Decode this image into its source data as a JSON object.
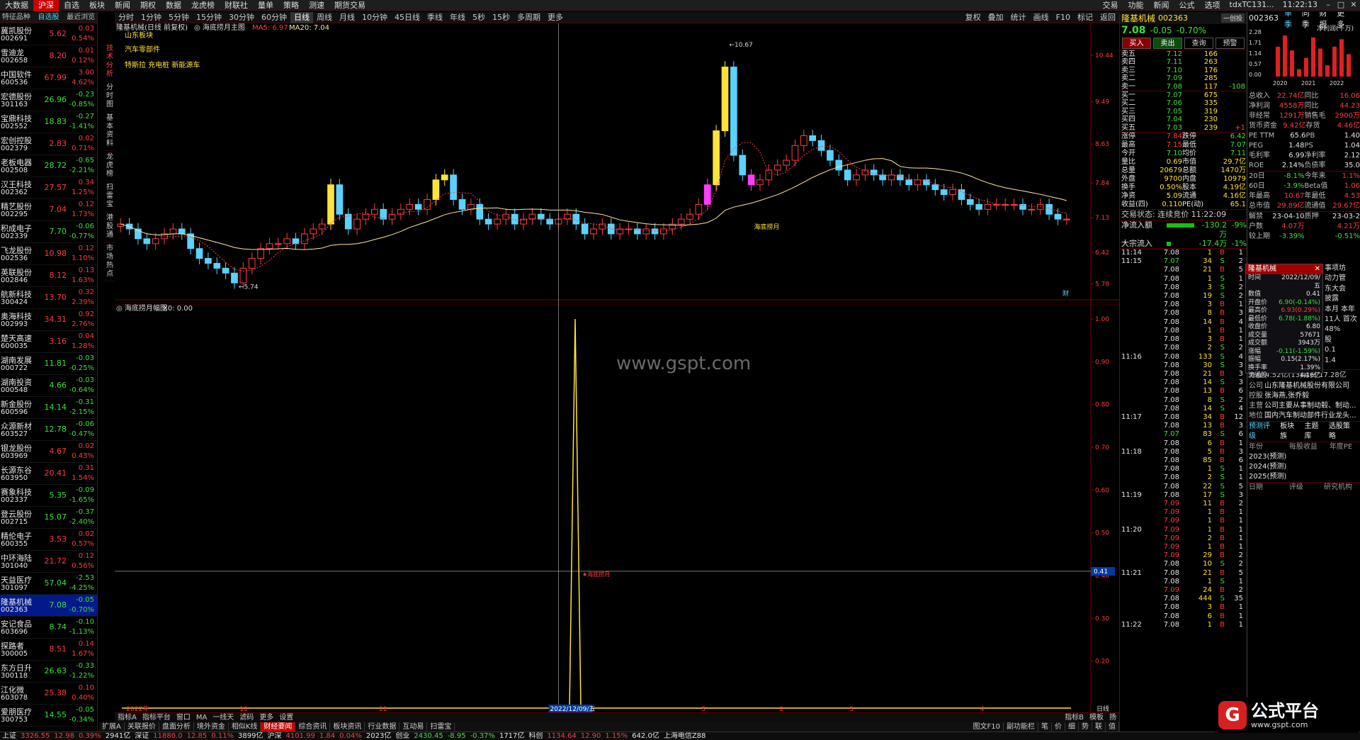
{
  "topbar": {
    "items": [
      "大数据",
      "沪深",
      "自选",
      "板块",
      "新闻",
      "期权",
      "数据",
      "龙虎榜",
      "财联社",
      "量单",
      "策略",
      "测速",
      "期货交易"
    ],
    "right": [
      "交易",
      "功能",
      "新闻",
      "公式",
      "选项"
    ],
    "account": "tdxTC131...",
    "time": "11:22:13",
    "active": "沪深"
  },
  "watchlist": {
    "tabs": [
      "特征品种",
      "自选股",
      "最近浏览"
    ],
    "rows": [
      {
        "name": "冀凯股份",
        "code": "002691",
        "price": "5.62",
        "chg": "0.03",
        "pct": "0.54%"
      },
      {
        "name": "雪迪龙",
        "code": "002658",
        "price": "8.20",
        "chg": "0.01",
        "pct": "0.12%"
      },
      {
        "name": "中国软件",
        "code": "600536",
        "price": "67.99",
        "chg": "3.00",
        "pct": "4.62%"
      },
      {
        "name": "宏德股份",
        "code": "301163",
        "price": "26.96",
        "chg": "-0.23",
        "pct": "-0.85%"
      },
      {
        "name": "宝鼎科技",
        "code": "002552",
        "price": "18.83",
        "chg": "-0.27",
        "pct": "-1.41%"
      },
      {
        "name": "宏创控股",
        "code": "002379",
        "price": "2.83",
        "chg": "0.02",
        "pct": "0.71%"
      },
      {
        "name": "老板电器",
        "code": "002508",
        "price": "28.72",
        "chg": "-0.65",
        "pct": "-2.21%"
      },
      {
        "name": "汉王科技",
        "code": "002362",
        "price": "27.57",
        "chg": "0.34",
        "pct": "1.25%"
      },
      {
        "name": "精艺股份",
        "code": "002295",
        "price": "7.04",
        "chg": "0.12",
        "pct": "1.73%"
      },
      {
        "name": "积成电子",
        "code": "002339",
        "price": "7.70",
        "chg": "-0.06",
        "pct": "-0.77%"
      },
      {
        "name": "飞龙股份",
        "code": "002536",
        "price": "10.98",
        "chg": "0.12",
        "pct": "1.10%"
      },
      {
        "name": "英联股份",
        "code": "002846",
        "price": "8.12",
        "chg": "0.13",
        "pct": "1.63%"
      },
      {
        "name": "航新科技",
        "code": "300424",
        "price": "13.70",
        "chg": "0.32",
        "pct": "2.39%"
      },
      {
        "name": "奥海科技",
        "code": "002993",
        "price": "34.31",
        "chg": "0.92",
        "pct": "2.76%"
      },
      {
        "name": "楚天高速",
        "code": "600035",
        "price": "3.16",
        "chg": "0.04",
        "pct": "1.28%"
      },
      {
        "name": "湖南发展",
        "code": "000722",
        "price": "11.81",
        "chg": "-0.03",
        "pct": "-0.25%"
      },
      {
        "name": "湖南投资",
        "code": "000548",
        "price": "4.66",
        "chg": "-0.03",
        "pct": "-0.64%"
      },
      {
        "name": "新金股份",
        "code": "600596",
        "price": "14.14",
        "chg": "-0.31",
        "pct": "-2.15%"
      },
      {
        "name": "众源新材",
        "code": "603527",
        "price": "12.78",
        "chg": "-0.06",
        "pct": "-0.47%"
      },
      {
        "name": "银龙股份",
        "code": "603969",
        "price": "4.67",
        "chg": "0.02",
        "pct": "0.43%"
      },
      {
        "name": "长源东谷",
        "code": "603950",
        "price": "20.41",
        "chg": "0.31",
        "pct": "1.54%"
      },
      {
        "name": "赛象科技",
        "code": "002337",
        "price": "5.35",
        "chg": "-0.09",
        "pct": "-1.65%"
      },
      {
        "name": "登云股份",
        "code": "002715",
        "price": "15.07",
        "chg": "-0.37",
        "pct": "-2.40%"
      },
      {
        "name": "精伦电子",
        "code": "600355",
        "price": "3.53",
        "chg": "0.02",
        "pct": "0.57%"
      },
      {
        "name": "中环海陆",
        "code": "301040",
        "price": "21.72",
        "chg": "0.12",
        "pct": "0.56%"
      },
      {
        "name": "天益医疗",
        "code": "301097",
        "price": "57.04",
        "chg": "-2.53",
        "pct": "-4.25%"
      },
      {
        "name": "隆基机械",
        "code": "002363",
        "price": "7.08",
        "chg": "-0.05",
        "pct": "-0.70%"
      },
      {
        "name": "安记食品",
        "code": "603696",
        "price": "8.74",
        "chg": "-0.10",
        "pct": "-1.13%"
      },
      {
        "name": "探路者",
        "code": "300005",
        "price": "8.51",
        "chg": "0.14",
        "pct": "1.67%"
      },
      {
        "name": "东方日升",
        "code": "300118",
        "price": "26.63",
        "chg": "-0.33",
        "pct": "-1.22%"
      },
      {
        "name": "江化微",
        "code": "603078",
        "price": "25.38",
        "chg": "0.10",
        "pct": "0.40%"
      },
      {
        "name": "爱朋医疗",
        "code": "300753",
        "price": "14.55",
        "chg": "-0.05",
        "pct": "-0.34%"
      }
    ],
    "selected_index": 26
  },
  "vtabs": [
    "技术分析",
    "分时图",
    "基本资料",
    "龙虎榜",
    "扫雷宝",
    "港股通",
    "市场热点"
  ],
  "periodbar": {
    "items": [
      "分时",
      "1分钟",
      "5分钟",
      "15分钟",
      "30分钟",
      "60分钟",
      "日线",
      "周线",
      "月线",
      "10分钟",
      "45日线",
      "季线",
      "年线",
      "5秒",
      "15秒",
      "多周期",
      "更多"
    ],
    "selected": "日线",
    "tools": [
      "复权",
      "叠加",
      "统计",
      "画线",
      "F10",
      "标记",
      "返回"
    ]
  },
  "chart": {
    "title_stock": "隆基机械(日线 前复权)",
    "title_indicator": "海底捞月主图",
    "ma5": "MA5: 6.97",
    "ma20": "MA20: 7.04",
    "concepts": [
      "山东板块",
      "汽车零部件",
      "特斯拉 充电桩 新能源车"
    ],
    "price_axis": [
      "10.44",
      "9.49",
      "8.63",
      "7.84",
      "7.13",
      "6.42",
      "5.78"
    ],
    "high_label": "10.67",
    "low_label": "5.74",
    "signal_label": "海底捞月",
    "sub_title": "海底捞月幅图",
    "sub_value": "X0: 0.00",
    "sub_axis": [
      "1.00",
      "0.90",
      "0.80",
      "0.70",
      "0.60",
      "0.50",
      "0.40",
      "0.30",
      "0.20"
    ],
    "sub_marker": "0.41",
    "sub_signal": "海底捞月",
    "time_labels": [
      "2022年",
      "10",
      "11",
      "12",
      "3",
      "2",
      "3",
      "4"
    ],
    "cursor_date": "2022/12/09/五",
    "axis_tag": "日线",
    "watermark_mid": "财",
    "watermark": "www.gspt.com"
  },
  "chart_data": {
    "type": "candlestick",
    "price_range": [
      5.6,
      10.8
    ],
    "candles_close": [
      7.0,
      6.9,
      6.7,
      6.6,
      6.7,
      6.8,
      6.9,
      6.8,
      6.5,
      6.3,
      6.2,
      6.1,
      6.0,
      5.8,
      6.1,
      6.3,
      6.5,
      6.6,
      6.6,
      6.7,
      6.6,
      6.8,
      6.9,
      7.0,
      7.8,
      7.2,
      6.9,
      7.1,
      7.2,
      7.3,
      7.1,
      7.2,
      7.3,
      7.4,
      7.3,
      7.5,
      7.9,
      8.0,
      7.5,
      7.3,
      7.4,
      7.1,
      7.0,
      7.1,
      7.2,
      7.0,
      7.1,
      7.2,
      7.1,
      7.0,
      7.1,
      7.2,
      7.0,
      6.8,
      6.9,
      7.0,
      6.8,
      6.9,
      6.9,
      6.8,
      6.9,
      6.8,
      6.9,
      7.0,
      7.1,
      7.2,
      7.4,
      7.8,
      8.9,
      10.2,
      8.4,
      8.0,
      7.8,
      7.9,
      8.1,
      8.2,
      8.3,
      8.6,
      8.8,
      8.7,
      8.5,
      8.3,
      8.1,
      7.9,
      8.0,
      8.1,
      8.0,
      7.9,
      8.0,
      7.9,
      7.8,
      7.9,
      7.8,
      7.7,
      7.6,
      7.7,
      7.5,
      7.4,
      7.3,
      7.4,
      7.4,
      7.4,
      7.4,
      7.3,
      7.3,
      7.4,
      7.2,
      7.1,
      7.1
    ],
    "subchart_signal_x": 0.48,
    "subchart_peak": 1.0
  },
  "right_panel": {
    "name": "隆基机械",
    "code": "002363",
    "btn": "一创投",
    "price": "7.08",
    "chg": "-0.05",
    "pct": "-0.70%",
    "trade_buttons": [
      "买入",
      "卖出",
      "查询",
      "预警"
    ],
    "asks": [
      {
        "l": "卖五",
        "p": "7.12",
        "v": "166",
        "x": ""
      },
      {
        "l": "卖四",
        "p": "7.11",
        "v": "263",
        "x": ""
      },
      {
        "l": "卖三",
        "p": "7.10",
        "v": "176",
        "x": ""
      },
      {
        "l": "卖二",
        "p": "7.09",
        "v": "285",
        "x": ""
      },
      {
        "l": "卖一",
        "p": "7.08",
        "v": "117",
        "x": "-108"
      }
    ],
    "bids": [
      {
        "l": "买一",
        "p": "7.07",
        "v": "675",
        "x": ""
      },
      {
        "l": "买二",
        "p": "7.06",
        "v": "335",
        "x": ""
      },
      {
        "l": "买三",
        "p": "7.05",
        "v": "319",
        "x": ""
      },
      {
        "l": "买四",
        "p": "7.04",
        "v": "230",
        "x": ""
      },
      {
        "l": "买五",
        "p": "7.03",
        "v": "239",
        "x": "+1"
      }
    ],
    "stats": [
      [
        "涨停",
        "7.84",
        "跌停",
        "6.42"
      ],
      [
        "最高",
        "7.15",
        "最低",
        "7.07"
      ],
      [
        "今开",
        "7.10",
        "均价",
        "7.11"
      ],
      [
        "量比",
        "0.69",
        "市值",
        "29.7亿"
      ],
      [
        "总量",
        "20679",
        "总额",
        "1470万"
      ],
      [
        "外盘",
        "9700",
        "内盘",
        "10979"
      ],
      [
        "换手",
        "0.50%",
        "股本",
        "4.19亿"
      ],
      [
        "净资",
        "5.09",
        "流通",
        "4.16亿"
      ],
      [
        "收益(四)",
        "0.110",
        "PE(动)",
        "65.1"
      ]
    ],
    "trade_status": "交易状态: 连续竞价 11:22:09",
    "flow1_label": "净流入额",
    "flow1_val": "-130.2万",
    "flow1_pct": "-9%",
    "flow2_label": "大宗流入",
    "flow2_val": "-17.4万",
    "flow2_pct": "-1%",
    "ticks": [
      [
        "11:14",
        "7.08",
        "1",
        "B",
        "1"
      ],
      [
        "11:15",
        "7.07",
        "34",
        "S",
        "2"
      ],
      [
        "",
        "7.08",
        "21",
        "B",
        "5"
      ],
      [
        "",
        "7.08",
        "1",
        "S",
        "1"
      ],
      [
        "",
        "7.08",
        "3",
        "S",
        "2"
      ],
      [
        "",
        "7.08",
        "19",
        "S",
        "2"
      ],
      [
        "",
        "7.08",
        "3",
        "B",
        "1"
      ],
      [
        "",
        "7.08",
        "8",
        "B",
        "3"
      ],
      [
        "",
        "7.08",
        "14",
        "B",
        "4"
      ],
      [
        "",
        "7.08",
        "1",
        "B",
        "1"
      ],
      [
        "",
        "7.08",
        "3",
        "B",
        "1"
      ],
      [
        "",
        "7.08",
        "2",
        "S",
        "2"
      ],
      [
        "11:16",
        "7.08",
        "133",
        "S",
        "4"
      ],
      [
        "",
        "7.08",
        "30",
        "S",
        "3"
      ],
      [
        "",
        "7.08",
        "21",
        "B",
        "3"
      ],
      [
        "",
        "7.08",
        "14",
        "S",
        "3"
      ],
      [
        "",
        "7.08",
        "13",
        "B",
        "6"
      ],
      [
        "",
        "7.08",
        "8",
        "S",
        "2"
      ],
      [
        "",
        "7.08",
        "14",
        "S",
        "4"
      ],
      [
        "11:17",
        "7.08",
        "34",
        "B",
        "12"
      ],
      [
        "",
        "7.08",
        "13",
        "B",
        "3"
      ],
      [
        "",
        "7.07",
        "83",
        "S",
        "6"
      ],
      [
        "",
        "7.08",
        "6",
        "B",
        "1"
      ],
      [
        "11:18",
        "7.08",
        "5",
        "B",
        "3"
      ],
      [
        "",
        "7.08",
        "85",
        "B",
        "6"
      ],
      [
        "",
        "7.08",
        "1",
        "S",
        "1"
      ],
      [
        "",
        "7.08",
        "2",
        "S",
        "1"
      ],
      [
        "",
        "7.08",
        "22",
        "S",
        "5"
      ],
      [
        "11:19",
        "7.08",
        "17",
        "S",
        "3"
      ],
      [
        "",
        "7.09",
        "11",
        "B",
        "2"
      ],
      [
        "",
        "7.09",
        "1",
        "B",
        "1"
      ],
      [
        "",
        "7.09",
        "1",
        "B",
        "1"
      ],
      [
        "11:20",
        "7.09",
        "1",
        "B",
        "1"
      ],
      [
        "",
        "7.09",
        "2",
        "B",
        "1"
      ],
      [
        "",
        "7.09",
        "1",
        "B",
        "1"
      ],
      [
        "",
        "7.09",
        "29",
        "B",
        "2"
      ],
      [
        "",
        "7.08",
        "10",
        "S",
        "2"
      ],
      [
        "11:21",
        "7.08",
        "21",
        "B",
        "5"
      ],
      [
        "",
        "7.08",
        "1",
        "S",
        "1"
      ],
      [
        "",
        "7.09",
        "24",
        "B",
        "2"
      ],
      [
        "",
        "7.08",
        "444",
        "S",
        "35"
      ],
      [
        "",
        "7.08",
        "3",
        "B",
        "1"
      ],
      [
        "",
        "7.08",
        "6",
        "B",
        "1"
      ],
      [
        "11:22",
        "7.08",
        "1",
        "B",
        "1"
      ]
    ]
  },
  "far_panel": {
    "code": "002363",
    "tabs": [
      "单季",
      "同季",
      "财报",
      "更多"
    ],
    "chart_label": "净利润(千万)",
    "chart_axis": [
      "2.28",
      "1.71",
      "1.14",
      "0.57",
      "0.00"
    ],
    "bar_years": [
      "2020",
      "2021",
      "2022"
    ],
    "bar_values": [
      1.6,
      2.2,
      1.4,
      0.4,
      1.0,
      2.1,
      1.5,
      0.6,
      1.6,
      2.0,
      1.2
    ],
    "rows": [
      [
        "总收入",
        "22.74亿",
        "同比",
        "16.06"
      ],
      [
        "净利润",
        "4558万",
        "同比",
        "44.23"
      ],
      [
        "非经常",
        "1291万",
        "销售毛",
        "2900万"
      ],
      [
        "货币资金",
        "9.42亿",
        "存货",
        "4.46亿"
      ],
      [
        "PE TTM",
        "65.6",
        "PB",
        "1.40"
      ],
      [
        "PEG",
        "1.48",
        "PS",
        "1.04"
      ],
      [
        "毛利率",
        "6.99",
        "净利率",
        "2.12"
      ],
      [
        "ROE",
        "2.14%",
        "负债率",
        "35.0"
      ]
    ],
    "rows2": [
      [
        "20日",
        "-8.1%",
        "今年来",
        "1.1%"
      ],
      [
        "60日",
        "-3.9%",
        "Beta值",
        "1.06"
      ],
      [
        "年最高",
        "10.67",
        "年最低",
        "4.53"
      ],
      [
        "总市值",
        "29.89亿",
        "流通值",
        "29.67亿"
      ]
    ],
    "rows3": [
      [
        "解禁",
        "23-04-10",
        "质押",
        "23-03-2"
      ],
      [
        "户数",
        "4.07万",
        "",
        "4.21万"
      ],
      [
        "较上期",
        "-3.39%",
        "",
        "-0.51%"
      ]
    ],
    "popup": {
      "title": "隆基机械",
      "rows": [
        [
          "时间",
          "2022/12/09/五"
        ],
        [
          "数值",
          "0.41"
        ],
        [
          "开盘价",
          "6.90(-0.14%)"
        ],
        [
          "最高价",
          "6.93(0.29%)"
        ],
        [
          "最低价",
          "6.78(-1.88%)"
        ],
        [
          "收盘价",
          "6.80"
        ],
        [
          "成交量",
          "57671"
        ],
        [
          "成交额",
          "3943万"
        ],
        [
          "涨幅",
          "-0.11(-1.59%)"
        ],
        [
          "振幅",
          "0.15(2.17%)"
        ],
        [
          "换手率",
          "1.39%"
        ],
        [
          "流通股",
          "4.16亿"
        ]
      ]
    },
    "side_text": [
      "事项坊",
      "动力管",
      "东大会",
      "披露",
      "本月 本年",
      "11人 首次",
      "48%",
      "股",
      "0.1",
      "1.4"
    ],
    "fenhong": "分红  4.52亿(13)募资  17.28亿",
    "company_rows": [
      [
        "公司",
        "山东隆基机械股份有限公司"
      ],
      [
        "控股",
        "张海燕,张乔毅"
      ],
      [
        "主营",
        "公司主要从事制动毂、制动..."
      ],
      [
        "地位",
        "国内汽车制动部件行业龙头..."
      ]
    ],
    "pred_tabs": [
      "预测评级",
      "板块族",
      "主题库",
      "选股策略"
    ],
    "pred_header": [
      "年份",
      "每股收益",
      "年度PE"
    ],
    "pred_years": [
      "2023(预测)",
      "2024(预测)",
      "2025(预测)"
    ],
    "rating_header": [
      "日期",
      "评级",
      "研究机构"
    ]
  },
  "bottom_tabs": [
    "指标A",
    "指标平台",
    "窗口",
    "MA",
    "一线天",
    "滤码",
    "更多",
    "设置"
  ],
  "bottom_tabs_right": [
    "指标B",
    "模板",
    "扬"
  ],
  "bottom_tabs2": [
    "扩展A",
    "关联报价",
    "盘面分析",
    "境外资金",
    "相似K线",
    "财经要闻",
    "综合资讯",
    "板块资讯",
    "行业数据",
    "互动易",
    "扫雷宝"
  ],
  "bottom_tabs2_sel": "财经要闻",
  "bottom_right": [
    "图文F10",
    "副功能栏"
  ],
  "bottom_right2": [
    "笔",
    "价",
    "细",
    "势",
    "联",
    "值"
  ],
  "statusbar": [
    {
      "t": "上证",
      "c": "wht"
    },
    {
      "t": "3326.55",
      "c": "red"
    },
    {
      "t": "12.98",
      "c": "red"
    },
    {
      "t": "0.39%",
      "c": "red"
    },
    {
      "t": "2941亿",
      "c": "wht"
    },
    {
      "t": "深证",
      "c": "wht"
    },
    {
      "t": "11880.0",
      "c": "red"
    },
    {
      "t": "12.85",
      "c": "red"
    },
    {
      "t": "0.11%",
      "c": "red"
    },
    {
      "t": "3899亿",
      "c": "wht"
    },
    {
      "t": "沪深",
      "c": "wht"
    },
    {
      "t": "4101.99",
      "c": "red"
    },
    {
      "t": "1.84",
      "c": "red"
    },
    {
      "t": "0.04%",
      "c": "red"
    },
    {
      "t": "2023亿",
      "c": "wht"
    },
    {
      "t": "创业",
      "c": "wht"
    },
    {
      "t": "2430.45",
      "c": "grn"
    },
    {
      "t": "-8.95",
      "c": "grn"
    },
    {
      "t": "-0.37%",
      "c": "grn"
    },
    {
      "t": "1717亿",
      "c": "wht"
    },
    {
      "t": "科创",
      "c": "wht"
    },
    {
      "t": "1134.64",
      "c": "red"
    },
    {
      "t": "12.90",
      "c": "red"
    },
    {
      "t": "1.15%",
      "c": "red"
    },
    {
      "t": "642.0亿",
      "c": "wht"
    },
    {
      "t": "上海电信Z88",
      "c": "wht"
    }
  ],
  "logo": {
    "mark": "G",
    "t1": "公式平台",
    "t2": "www.gspt.com"
  }
}
